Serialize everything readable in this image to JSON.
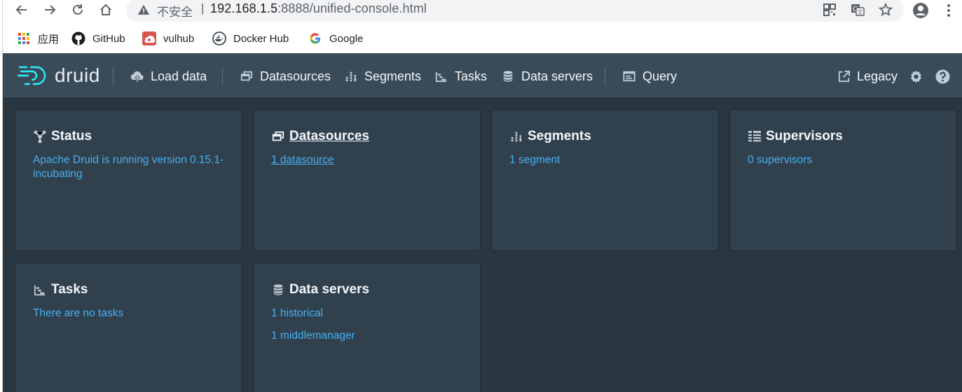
{
  "browser": {
    "insecure_label": "不安全",
    "url_host": "192.168.1.5",
    "url_port_path": ":8888/unified-console.html",
    "icons": [
      "back-icon",
      "forward-icon",
      "reload-icon",
      "home-icon",
      "warning-icon",
      "qr-code-icon",
      "translate-icon",
      "star-icon",
      "account-icon",
      "menu-icon"
    ]
  },
  "bookmarks": [
    {
      "label": "应用",
      "icon": "apps-grid-icon"
    },
    {
      "label": "GitHub",
      "icon": "github-icon"
    },
    {
      "label": "vulhub",
      "icon": "vulhub-icon"
    },
    {
      "label": "Docker Hub",
      "icon": "docker-icon"
    },
    {
      "label": "Google",
      "icon": "google-icon"
    }
  ],
  "app": {
    "logo_text": "druid",
    "nav": {
      "load_data": "Load data",
      "datasources": "Datasources",
      "segments": "Segments",
      "tasks": "Tasks",
      "data_servers": "Data servers",
      "query": "Query",
      "legacy": "Legacy"
    },
    "colors": {
      "background": "#293742",
      "navbar": "#394b59",
      "card": "#30404d",
      "link": "#48aff0"
    }
  },
  "cards": {
    "status": {
      "title": "Status",
      "line1": "Apache Druid is running version 0.15.1-incubating"
    },
    "datasources": {
      "title": "Datasources",
      "line1": "1 datasource"
    },
    "segments": {
      "title": "Segments",
      "line1": "1 segment"
    },
    "supervisors": {
      "title": "Supervisors",
      "line1": "0 supervisors"
    },
    "tasks": {
      "title": "Tasks",
      "line1": "There are no tasks"
    },
    "data_servers": {
      "title": "Data servers",
      "line1": "1 historical",
      "line2": "1 middlemanager"
    }
  }
}
